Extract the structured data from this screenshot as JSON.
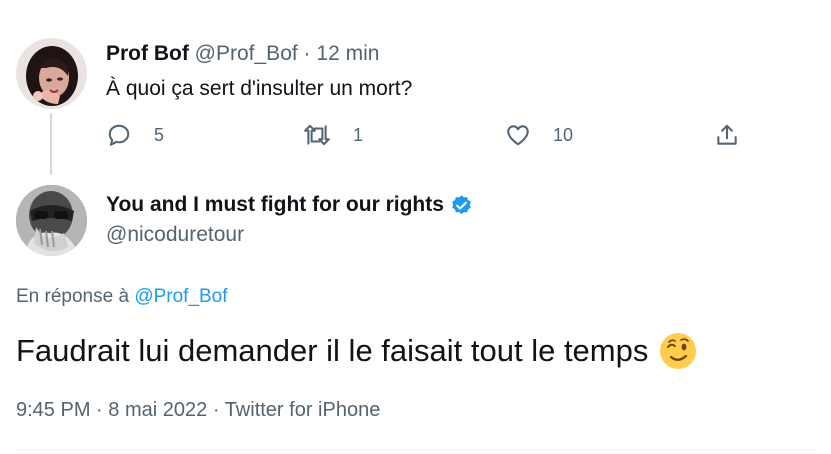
{
  "parent_tweet": {
    "display_name": "Prof Bof",
    "handle": "@Prof_Bof",
    "separator": "·",
    "time": "12 min",
    "text": "À quoi ça sert d'insulter un mort?",
    "avatar_icon": "profile-photo",
    "actions": {
      "reply_count": "5",
      "retweet_count": "1",
      "like_count": "10"
    }
  },
  "main_tweet": {
    "display_name": "You and I must fight for our rights",
    "handle": "@nicoduretour",
    "verified": true,
    "avatar_icon": "profile-photo",
    "reply_prefix": "En réponse à",
    "reply_mention": "@Prof_Bof",
    "text": "Faudrait lui demander il le faisait tout le temps",
    "emoji": "winking-face",
    "time": "9:45 PM",
    "separator": "·",
    "date": "8 mai 2022",
    "source": "Twitter for iPhone"
  },
  "colors": {
    "text_primary": "#0f1419",
    "text_secondary": "#536471",
    "accent": "#1d9bf0",
    "thread_line": "#cfd9de"
  }
}
